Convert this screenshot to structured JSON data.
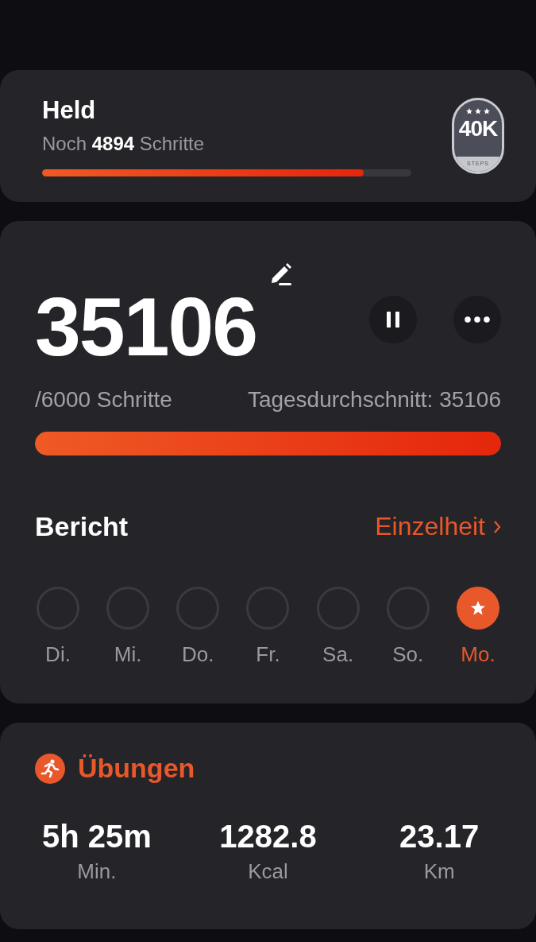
{
  "goal": {
    "title": "Held",
    "remaining": "Noch **4894** Schritte",
    "level": 0.87,
    "badge": {
      "value": "40K",
      "caption": "STEPS"
    }
  },
  "steps": {
    "count": "35106",
    "target": "/6000 Schritte",
    "average": "Tagesdurchschnitt: 35106",
    "level": 1,
    "paused": false
  },
  "report": {
    "title": "Bericht",
    "link": "Einzelheit",
    "days": [
      {
        "label": "Di.",
        "achieved": false,
        "selected": false
      },
      {
        "label": "Mi.",
        "achieved": false,
        "selected": false
      },
      {
        "label": "Do.",
        "achieved": false,
        "selected": false
      },
      {
        "label": "Fr.",
        "achieved": false,
        "selected": false
      },
      {
        "label": "Sa.",
        "achieved": false,
        "selected": false
      },
      {
        "label": "So.",
        "achieved": false,
        "selected": false
      },
      {
        "label": "Mo.",
        "achieved": true,
        "selected": true
      }
    ]
  },
  "exercise": {
    "title": "Übungen",
    "stats": [
      {
        "value": "5h 25m",
        "unit": "Min."
      },
      {
        "value": "1282.8",
        "unit": "Kcal"
      },
      {
        "value": "23.17",
        "unit": "Km"
      }
    ]
  }
}
